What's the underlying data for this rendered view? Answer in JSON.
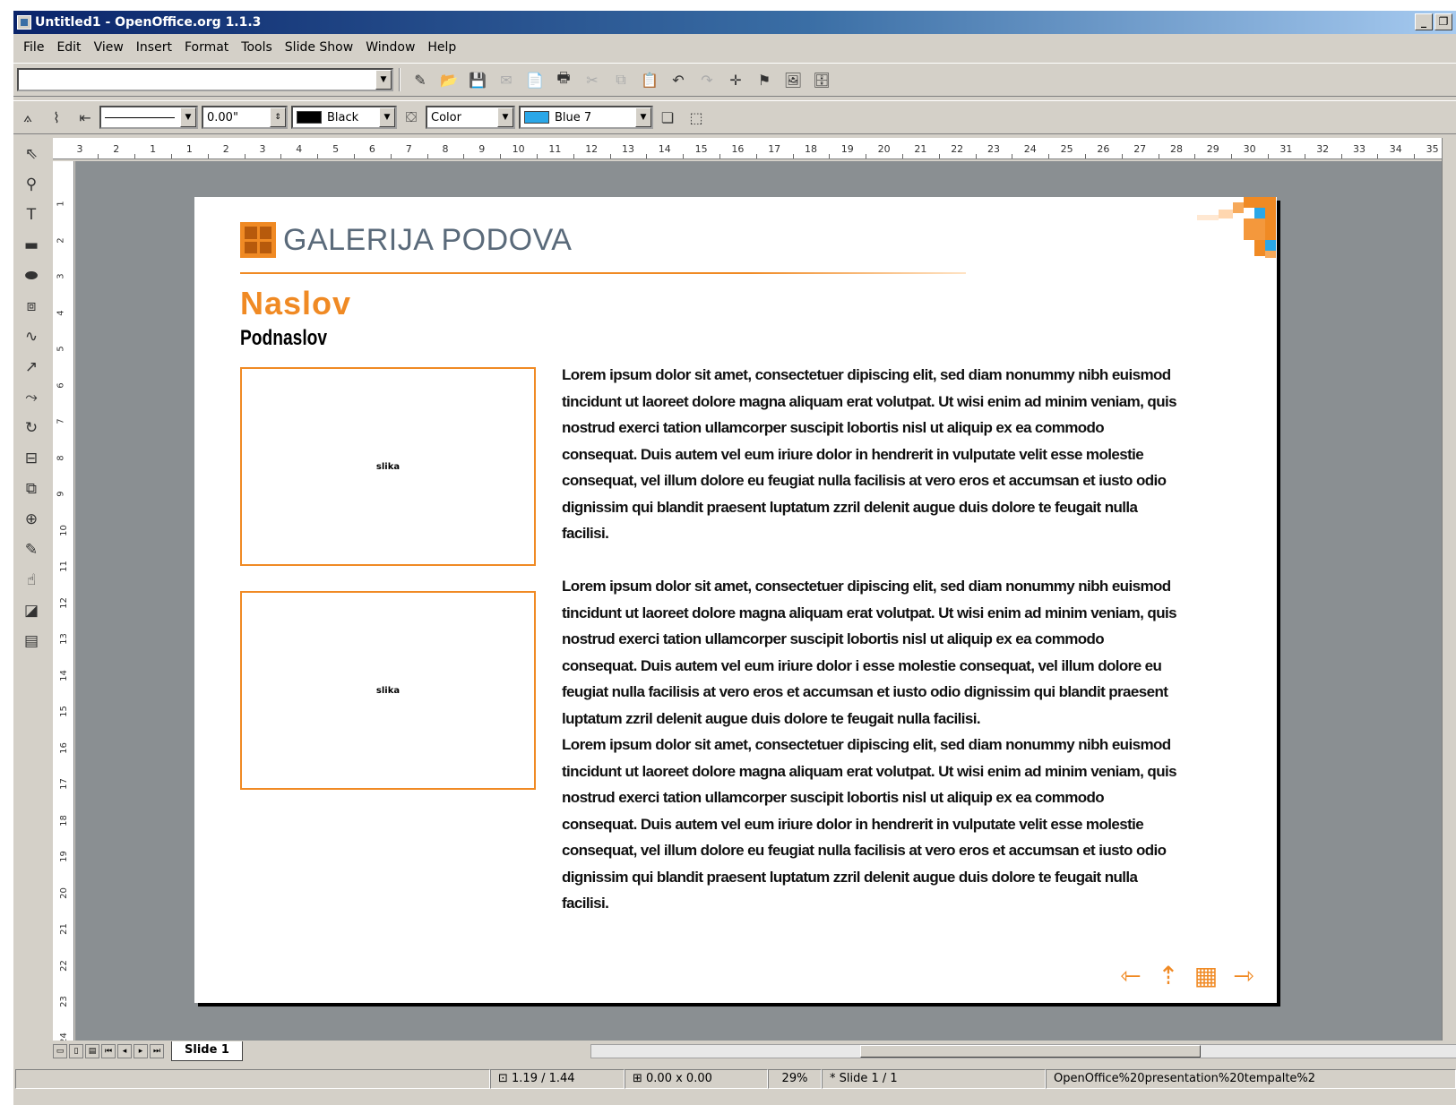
{
  "window": {
    "title": "Untitled1 - OpenOffice.org 1.1.3"
  },
  "menu": [
    "File",
    "Edit",
    "View",
    "Insert",
    "Format",
    "Tools",
    "Slide Show",
    "Window",
    "Help"
  ],
  "toolbar2": {
    "line_width": "0.00\"",
    "line_color": "Black",
    "area_style": "Color",
    "area_color": "Blue 7"
  },
  "colors": {
    "accent": "#f08a24",
    "line_black": "#000000",
    "area_blue": "#2aa7e8",
    "titlebar": "#0a246a"
  },
  "ruler_h": [
    "3",
    "2",
    "1",
    "1",
    "2",
    "3",
    "4",
    "5",
    "6",
    "7",
    "8",
    "9",
    "10",
    "11",
    "12",
    "13",
    "14",
    "15",
    "16",
    "17",
    "18",
    "19",
    "20",
    "21",
    "22",
    "23",
    "24",
    "25",
    "26",
    "27",
    "28",
    "29",
    "30",
    "31",
    "32",
    "33",
    "34",
    "35"
  ],
  "ruler_v": [
    "1",
    "2",
    "3",
    "4",
    "5",
    "6",
    "7",
    "8",
    "9",
    "10",
    "11",
    "12",
    "13",
    "14",
    "15",
    "16",
    "17",
    "18",
    "19",
    "20",
    "21",
    "22",
    "23",
    "24"
  ],
  "slide": {
    "logo_text": "GALERIJA PODOVA",
    "title": "Naslov",
    "subtitle": "Podnaslov",
    "image_placeholder_1": "slika",
    "image_placeholder_2": "slika",
    "paragraph_1": "Lorem ipsum dolor sit amet, consectetuer dipiscing elit, sed diam nonummy nibh euismod tincidunt ut laoreet dolore magna aliquam erat volutpat. Ut wisi enim ad minim veniam, quis nostrud exerci tation ullamcorper suscipit lobortis nisl ut aliquip ex ea commodo consequat. Duis autem vel eum iriure dolor in hendrerit in vulputate velit esse molestie consequat, vel illum dolore eu feugiat nulla facilisis at vero eros et accumsan et iusto odio dignissim qui blandit praesent luptatum zzril delenit augue duis dolore te feugait nulla facilisi.",
    "paragraph_2": "Lorem ipsum dolor sit amet, consectetuer dipiscing elit, sed diam nonummy nibh euismod tincidunt ut laoreet dolore magna aliquam erat volutpat. Ut wisi enim ad minim veniam, quis nostrud exerci tation ullamcorper suscipit lobortis nisl ut aliquip ex ea commodo consequat. Duis autem vel eum iriure dolor i esse molestie consequat, vel illum dolore eu feugiat nulla facilisis at vero eros et accumsan et iusto odio dignissim qui blandit praesent luptatum zzril delenit augue duis dolore te feugait nulla facilisi.",
    "paragraph_3": "Lorem ipsum dolor sit amet, consectetuer dipiscing elit, sed diam nonummy nibh euismod tincidunt ut laoreet dolore magna aliquam erat volutpat. Ut wisi enim ad minim veniam, quis nostrud exerci tation ullamcorper suscipit lobortis nisl ut aliquip ex ea commodo consequat. Duis autem vel eum iriure dolor in hendrerit in vulputate velit esse molestie consequat, vel illum dolore eu feugiat nulla facilisis at vero eros et accumsan et iusto odio dignissim qui blandit praesent luptatum zzril delenit augue duis dolore te feugait nulla facilisi."
  },
  "tabs": {
    "active": "Slide 1"
  },
  "status": {
    "position": "1.19 / 1.44",
    "size": "0.00 x 0.00",
    "zoom": "29%",
    "slide": "Slide 1 / 1",
    "document": "OpenOffice%20presentation%20tempalte%2"
  }
}
